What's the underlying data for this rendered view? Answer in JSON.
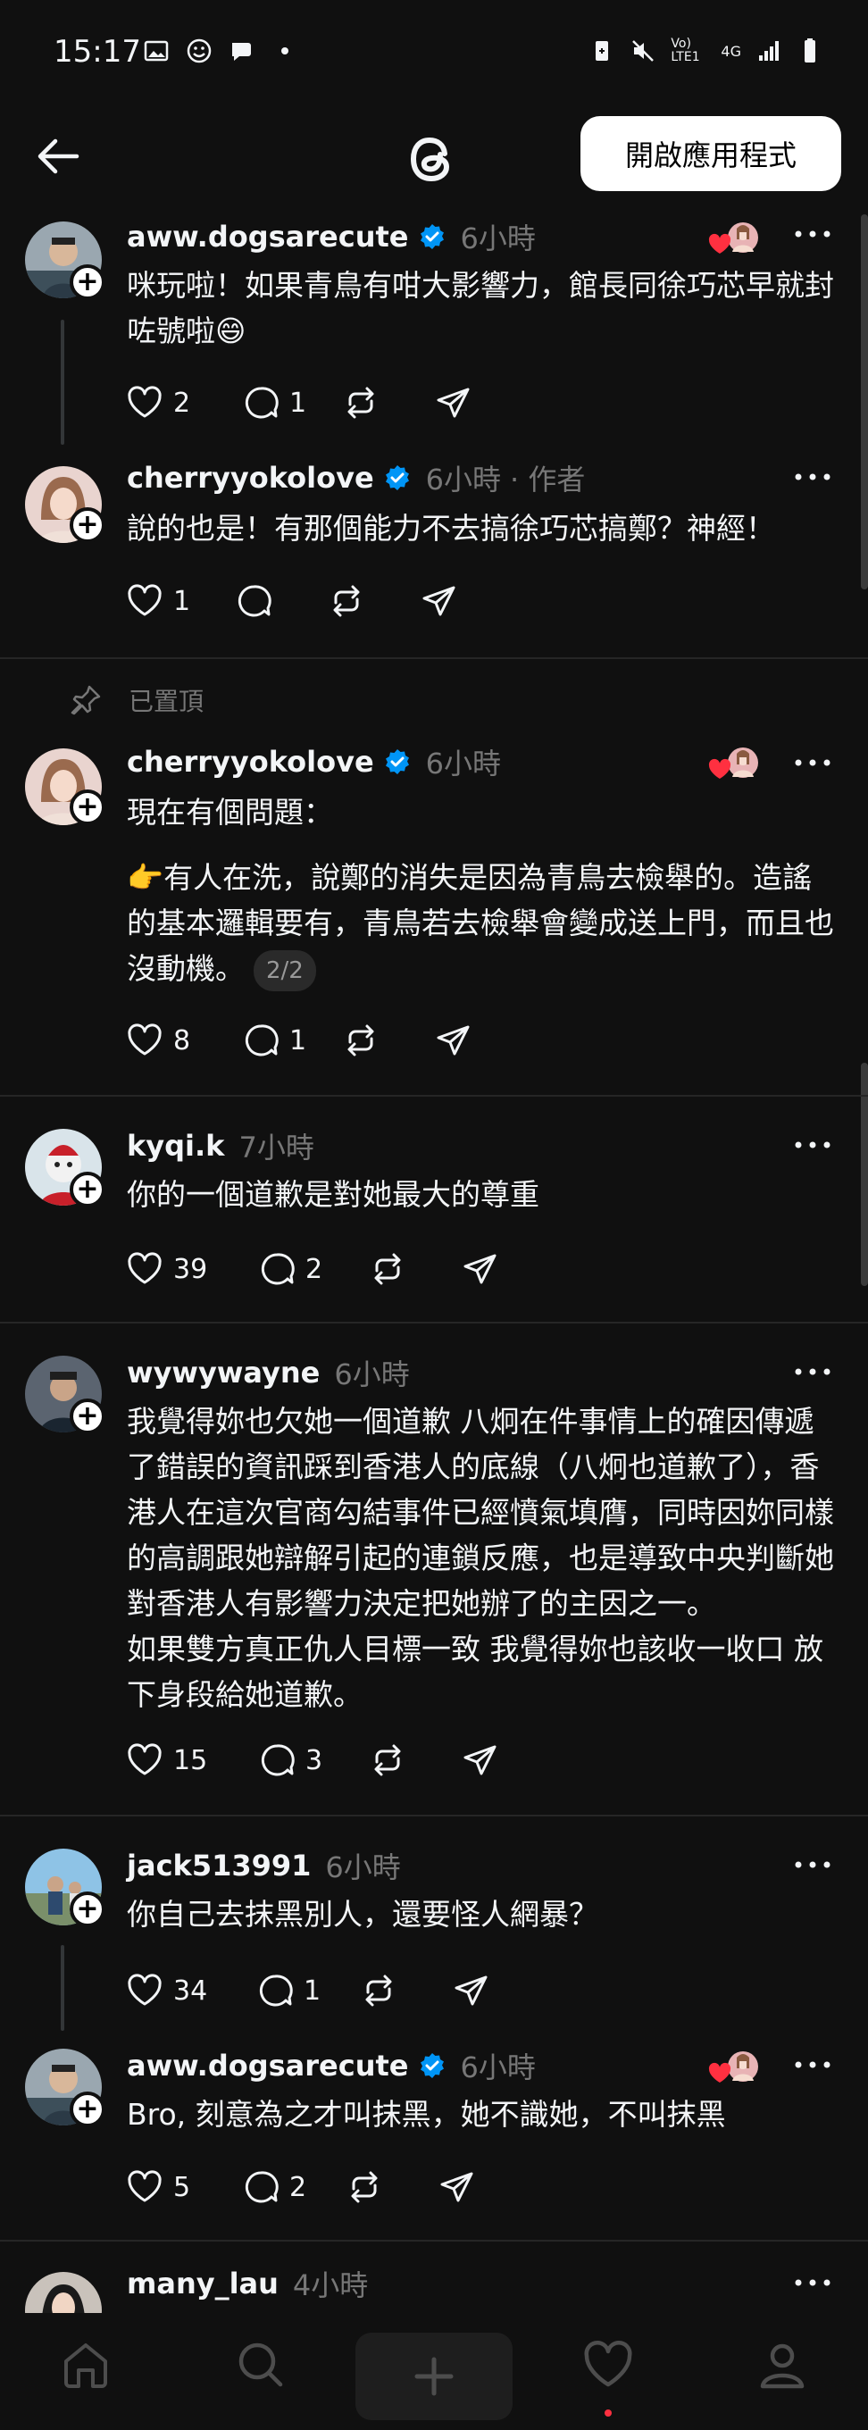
{
  "status_bar": {
    "time": "15:17",
    "network": "Vo) LTE1",
    "net_type": "4G"
  },
  "topbar": {
    "open_app_label": "開啟應用程式"
  },
  "posts": [
    {
      "username": "aww.dogsarecute",
      "verified": true,
      "time": "6小時",
      "body": [
        "咪玩啦！如果青鳥有咁大影響力，館長同徐巧芯早就封咗號啦😄"
      ],
      "likes": "2",
      "replies": "1"
    },
    {
      "username": "cherryyokolove",
      "verified": true,
      "time": "6小時",
      "author_tag": "· 作者",
      "body": [
        "說的也是！有那個能力不去搞徐巧芯搞鄭？神經！"
      ],
      "likes": "1",
      "replies": ""
    },
    {
      "pinned_label": "已置頂",
      "username": "cherryyokolove",
      "verified": true,
      "time": "6小時",
      "body": [
        "現在有個問題：",
        "👉有人在洗，說鄭的消失是因為青鳥去檢舉的。造謠的基本邏輯要有，青鳥若去檢舉會變成送上門，而且也沒動機。"
      ],
      "pager": "2/2",
      "likes": "8",
      "replies": "1"
    },
    {
      "username": "kyqi.k",
      "verified": false,
      "time": "7小時",
      "body": [
        "你的一個道歉是對她最大的尊重"
      ],
      "likes": "39",
      "replies": "2"
    },
    {
      "username": "wywywayne",
      "verified": false,
      "time": "6小時",
      "body": [
        "我覺得妳也欠她一個道歉 八炯在件事情上的確因傳遞了錯誤的資訊踩到香港人的底線（八炯也道歉了），香港人在這次官商勾結事件已經憤氣填膺，同時因妳同樣的高調跟她辯解引起的連鎖反應，也是導致中央判斷她對香港人有影響力決定把她辦了的主因之一。",
        "如果雙方真正仇人目標一致 我覺得妳也該收一收口 放下身段給她道歉。"
      ],
      "likes": "15",
      "replies": "3"
    },
    {
      "username": "jack513991",
      "verified": false,
      "time": "6小時",
      "body": [
        "你自己去抹黑別人，還要怪人網暴？"
      ],
      "likes": "34",
      "replies": "1"
    },
    {
      "username": "aww.dogsarecute",
      "verified": true,
      "time": "6小時",
      "body": [
        "Bro, 刻意為之才叫抹黑，她不識她，不叫抹黑"
      ],
      "likes": "5",
      "replies": "2"
    },
    {
      "username": "many_lau",
      "verified": false,
      "time": "4小時",
      "body": [],
      "likes": "",
      "replies": ""
    }
  ],
  "bottom_nav": [
    "home-icon",
    "search-icon",
    "create-icon",
    "activity-icon",
    "profile-icon"
  ],
  "colors": {
    "background": "#101010",
    "verified": "#0095f6",
    "like_red": "#ff3040",
    "muted": "#777777"
  }
}
